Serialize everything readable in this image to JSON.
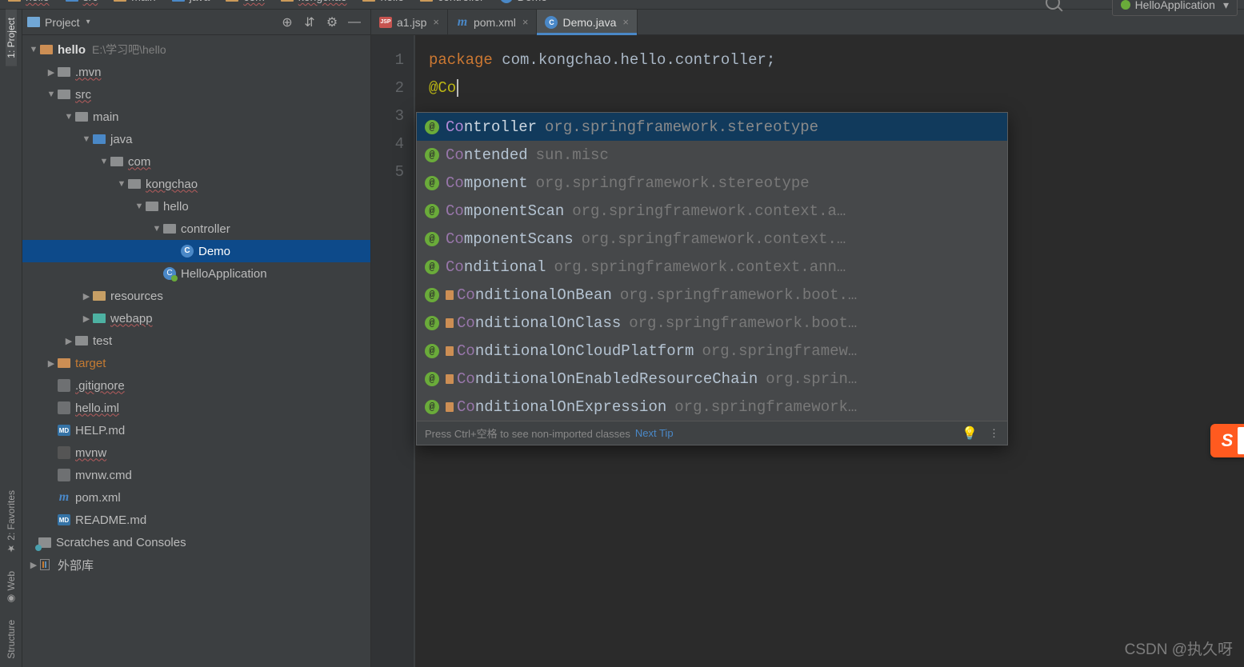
{
  "breadcrumbs": [
    "hello",
    "src",
    "main",
    "java",
    "com",
    "kongchao",
    "hello",
    "controller",
    "Demo"
  ],
  "run_config": "HelloApplication",
  "tool_stripe": {
    "project": "1: Project",
    "favorites": "2: Favorites",
    "web": "Web",
    "structure": "Structure"
  },
  "project_header": {
    "title": "Project"
  },
  "tree": {
    "root": {
      "name": "hello",
      "path": "E:\\学习吧\\hello"
    },
    "mvn": ".mvn",
    "src": "src",
    "main": "main",
    "java": "java",
    "com": "com",
    "kongchao": "kongchao",
    "hello": "hello",
    "controller": "controller",
    "demo": "Demo",
    "helloApp": "HelloApplication",
    "resources": "resources",
    "webapp": "webapp",
    "test": "test",
    "target": "target",
    "gitignore": ".gitignore",
    "helloiml": "hello.iml",
    "helpmd": "HELP.md",
    "mvnw": "mvnw",
    "mvnwcmd": "mvnw.cmd",
    "pom": "pom.xml",
    "readme": "README.md",
    "scratches": "Scratches and Consoles",
    "external": "外部库"
  },
  "tabs": [
    {
      "label": "a1.jsp",
      "icon": "jsp"
    },
    {
      "label": "pom.xml",
      "icon": "mvn"
    },
    {
      "label": "Demo.java",
      "icon": "cls",
      "active": true
    }
  ],
  "gutter": [
    "1",
    "2",
    "3",
    "4",
    "5"
  ],
  "code": {
    "pkg_kw": "package",
    "pkg_name": " com.kongchao.hello.controller;",
    "ann": "@Co"
  },
  "completion": {
    "items": [
      {
        "match": "Co",
        "rest": "ntroller",
        "pkg": "org.springframework.stereotype",
        "selected": true,
        "cond": false
      },
      {
        "match": "Co",
        "rest": "ntended",
        "pkg": "sun.misc",
        "cond": false
      },
      {
        "match": "Co",
        "rest": "mponent",
        "pkg": "org.springframework.stereotype",
        "cond": false
      },
      {
        "match": "Co",
        "rest": "mponentScan",
        "pkg": "org.springframework.context.a…",
        "cond": false
      },
      {
        "match": "Co",
        "rest": "mponentScans",
        "pkg": "org.springframework.context.…",
        "cond": false
      },
      {
        "match": "Co",
        "rest": "nditional",
        "pkg": "org.springframework.context.ann…",
        "cond": false
      },
      {
        "match": "Co",
        "rest": "nditionalOnBean",
        "pkg": "org.springframework.boot.…",
        "cond": true
      },
      {
        "match": "Co",
        "rest": "nditionalOnClass",
        "pkg": "org.springframework.boot…",
        "cond": true
      },
      {
        "match": "Co",
        "rest": "nditionalOnCloudPlatform",
        "pkg": "org.springframew…",
        "cond": true
      },
      {
        "match": "Co",
        "rest": "nditionalOnEnabledResourceChain",
        "pkg": "org.sprin…",
        "cond": true
      },
      {
        "match": "Co",
        "rest": "nditionalOnExpression",
        "pkg": "org.springframework…",
        "cond": true
      }
    ],
    "footer_hint": "Press Ctrl+空格 to see non-imported classes",
    "footer_link": "Next Tip"
  },
  "watermark": "CSDN @执久呀",
  "sogou": "S"
}
